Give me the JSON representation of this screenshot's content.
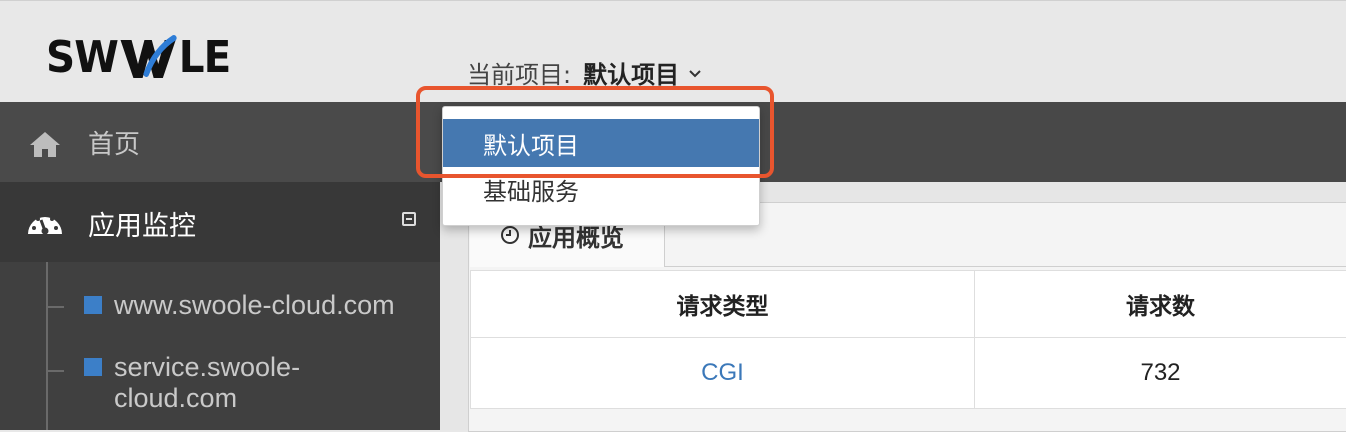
{
  "header": {
    "logo_text_left": "SW",
    "logo_text_right": "LE",
    "project_prefix": "当前项目:",
    "current_project": "默认项目"
  },
  "sidebar": {
    "home_label": "首页",
    "monitor_label": "应用监控",
    "sub_items": [
      {
        "label": "www.swoole-cloud.com"
      },
      {
        "label": "service.swoole-cloud.com"
      }
    ]
  },
  "dropdown": {
    "options": [
      {
        "label": "默认项目",
        "selected": true
      },
      {
        "label": "基础服务",
        "selected": false
      }
    ]
  },
  "main": {
    "tab_label": "应用概览",
    "table": {
      "headers": [
        "请求类型",
        "请求数"
      ],
      "rows": [
        [
          "CGI",
          "732"
        ]
      ]
    }
  },
  "colors": {
    "accent": "#4578b0",
    "link": "#3b78b9",
    "highlight": "#e8552e",
    "sidebar_bg": "#404040"
  },
  "icons": {
    "home": "home-icon",
    "monitor": "dashboard-gauge-icon",
    "collapse": "minus-square-icon",
    "tab": "clock-icon",
    "chevron": "chevron-down-icon"
  }
}
